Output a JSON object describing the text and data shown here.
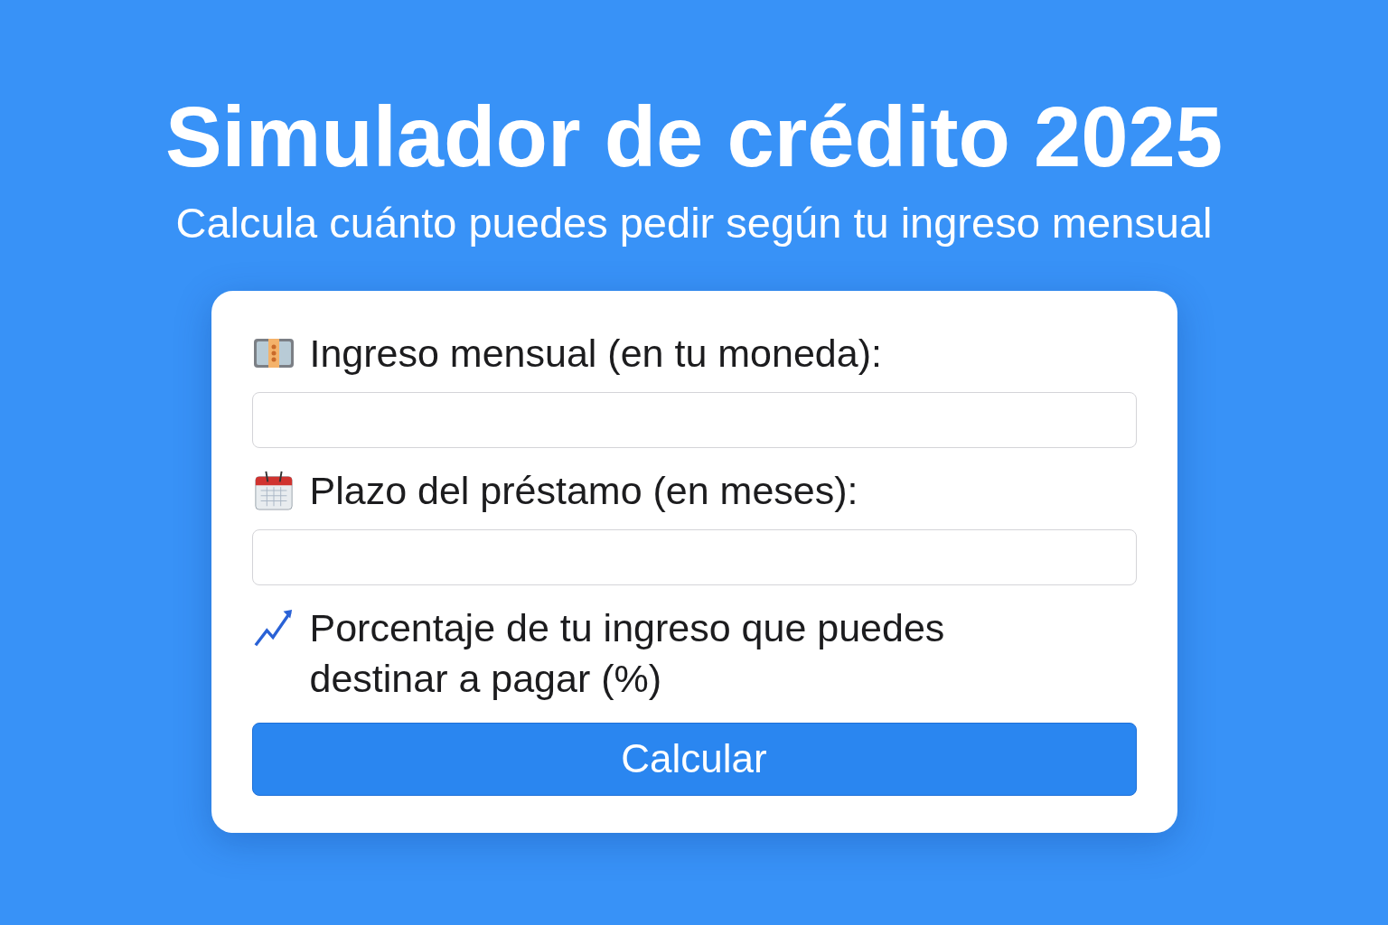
{
  "title": "Simulador de crédito 2025",
  "subtitle": "Calcula cuánto puedes pedir según tu ingreso mensual",
  "fields": [
    {
      "kind": "text-input",
      "label": "Ingreso mensual (en tu moneda):"
    },
    {
      "kind": "text-input",
      "label": "Plazo del préstamo (en meses):"
    },
    {
      "kind": "label-only",
      "label": "Porcentaje de tu ingreso que puedes destinar a pagar (%)"
    }
  ],
  "button": "Calcular"
}
